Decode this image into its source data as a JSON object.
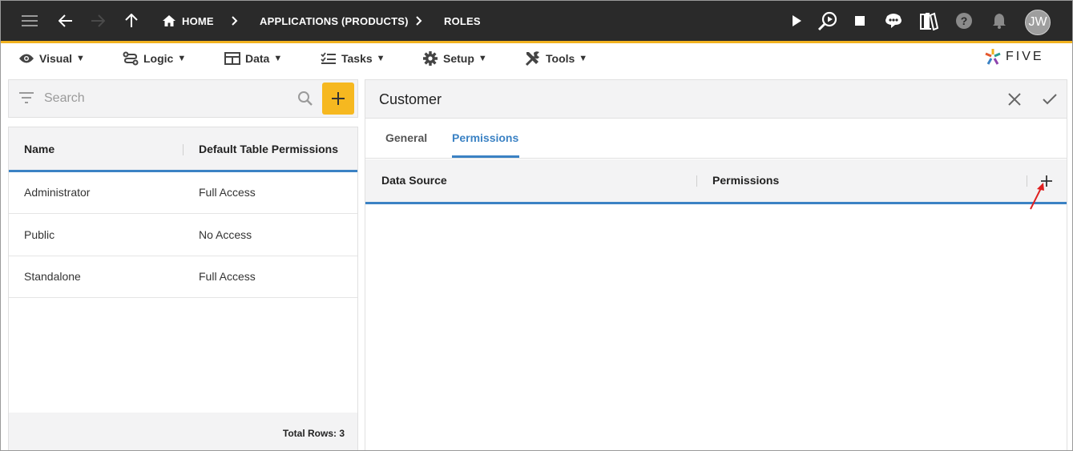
{
  "topbar": {
    "breadcrumbs": [
      "HOME",
      "APPLICATIONS (PRODUCTS)",
      "ROLES"
    ],
    "avatar_initials": "JW",
    "accent": "#f2b21f"
  },
  "menubar": {
    "items": [
      {
        "label": "Visual",
        "icon": "eye-icon"
      },
      {
        "label": "Logic",
        "icon": "logic-icon"
      },
      {
        "label": "Data",
        "icon": "table-icon"
      },
      {
        "label": "Tasks",
        "icon": "checklist-icon"
      },
      {
        "label": "Setup",
        "icon": "gear-icon"
      },
      {
        "label": "Tools",
        "icon": "tools-icon"
      }
    ],
    "logo_text": "FIVE"
  },
  "left": {
    "search_placeholder": "Search",
    "columns": [
      "Name",
      "Default Table Permissions"
    ],
    "rows": [
      {
        "name": "Administrator",
        "permissions": "Full Access"
      },
      {
        "name": "Public",
        "permissions": "No Access"
      },
      {
        "name": "Standalone",
        "permissions": "Full Access"
      }
    ],
    "total_rows": "Total Rows: 3"
  },
  "right": {
    "title": "Customer",
    "tabs": [
      "General",
      "Permissions"
    ],
    "active_tab": "Permissions",
    "columns": [
      "Data Source",
      "Permissions"
    ]
  },
  "colors": {
    "topbar_bg": "#2a2a2a",
    "add_button": "#f6b820",
    "active_blue": "#3b82c4",
    "annotation_arrow": "#e02020"
  }
}
